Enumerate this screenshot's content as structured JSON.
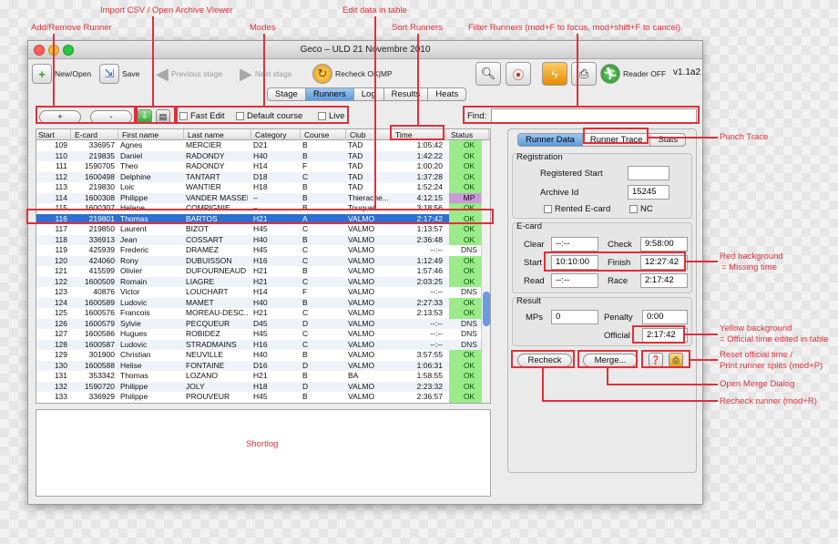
{
  "annotations": {
    "add_remove": "Add/Remove Runner",
    "import_csv": "Import CSV / Open Archive Viewer",
    "modes": "Modes",
    "edit_data": "Edit data in table",
    "sort_runners": "Sort Runners",
    "filter_runners": "Filter Runners (mod+F to focus, mod+shift+F to cancel)",
    "punch_trace": "Punch Trace",
    "red_background_1": "Red background",
    "red_background_2": "= Missing time",
    "yellow_background_1": "Yellow background",
    "yellow_background_2": "= Official time edited in table",
    "reset_official_1": "Reset official time /",
    "reset_official_2": "Print runner splits (mod+P)",
    "open_merge": "Open Merge Dialog",
    "recheck_runner": "Recheck runner (mod+R)",
    "shortlog": "Shortlog"
  },
  "window": {
    "title": "Geco – ULD 21 Novembre 2010",
    "version": "v1.1a2"
  },
  "toolbar": {
    "new_open": "New/Open",
    "save": "Save",
    "previous_stage": "Previous stage",
    "next_stage": "Next stage",
    "recheck": "Recheck OK|MP",
    "reader": "Reader OFF"
  },
  "tabs": [
    "Stage",
    "Runners",
    "Log",
    "Results",
    "Heats"
  ],
  "controls": {
    "add": "+",
    "remove": "-",
    "fast_edit": "Fast Edit",
    "default_course": "Default course",
    "live": "Live",
    "find_label": "Find:",
    "find_value": ""
  },
  "table": {
    "headers": [
      "Start",
      "E-card",
      "First name",
      "Last name",
      "Category",
      "Course",
      "Club",
      "Time",
      "Status"
    ],
    "rows": [
      [
        "109",
        "336957",
        "Agnes",
        "MERCIER",
        "D21",
        "B",
        "TAD",
        "1:05:42",
        "OK"
      ],
      [
        "110",
        "219835",
        "Daniel",
        "RADONDY",
        "H40",
        "B",
        "TAD",
        "1:42:22",
        "OK"
      ],
      [
        "111",
        "1590705",
        "Theo",
        "RADONDY",
        "H14",
        "F",
        "TAD",
        "1:00:20",
        "OK"
      ],
      [
        "112",
        "1600498",
        "Delphine",
        "TANTART",
        "D18",
        "C",
        "TAD",
        "1:37:28",
        "OK"
      ],
      [
        "113",
        "219830",
        "Loic",
        "WANTIER",
        "H18",
        "B",
        "TAD",
        "1:52:24",
        "OK"
      ],
      [
        "114",
        "1600308",
        "Philippe",
        "VANDER MASSEN",
        "–",
        "B",
        "Thierache...",
        "4:12:15",
        "MP"
      ],
      [
        "115",
        "1600307",
        "Helene",
        "COMPIGNIE",
        "–",
        "B",
        "Touquet...",
        "3:18:56",
        "OK"
      ],
      [
        "116",
        "219801",
        "Thomas",
        "BARTOS",
        "H21",
        "A",
        "VALMO",
        "2:17:42",
        "OK"
      ],
      [
        "117",
        "219850",
        "Laurent",
        "BIZOT",
        "H45",
        "C",
        "VALMO",
        "1:13:57",
        "OK"
      ],
      [
        "118",
        "336913",
        "Jean",
        "COSSART",
        "H40",
        "B",
        "VALMO",
        "2:36:48",
        "OK"
      ],
      [
        "119",
        "425939",
        "Frederic",
        "DRAMEZ",
        "H45",
        "C",
        "VALMO",
        "--:--",
        "DNS"
      ],
      [
        "120",
        "424060",
        "Rony",
        "DUBUISSON",
        "H16",
        "C",
        "VALMO",
        "1:12:49",
        "OK"
      ],
      [
        "121",
        "415599",
        "Olivier",
        "DUFOURNEAUD",
        "H21",
        "B",
        "VALMO",
        "1:57:46",
        "OK"
      ],
      [
        "122",
        "1600509",
        "Romain",
        "LIAGRE",
        "H21",
        "C",
        "VALMO",
        "2:03:25",
        "OK"
      ],
      [
        "123",
        "40876",
        "Victor",
        "LOUCHART",
        "H14",
        "F",
        "VALMO",
        "--:--",
        "DNS"
      ],
      [
        "124",
        "1600589",
        "Ludovic",
        "MAMET",
        "H40",
        "B",
        "VALMO",
        "2:27:33",
        "OK"
      ],
      [
        "125",
        "1600576",
        "Francois",
        "MOREAU-DESC...",
        "H21",
        "C",
        "VALMO",
        "2:13:53",
        "OK"
      ],
      [
        "126",
        "1600579",
        "Sylvie",
        "PECQUEUR",
        "D45",
        "D",
        "VALMO",
        "--:--",
        "DNS"
      ],
      [
        "127",
        "1600586",
        "Hugues",
        "ROBIDEZ",
        "H45",
        "C",
        "VALMO",
        "--:--",
        "DNS"
      ],
      [
        "128",
        "1600587",
        "Ludovic",
        "STRADMAINS",
        "H16",
        "C",
        "VALMO",
        "--:--",
        "DNS"
      ],
      [
        "129",
        "301900",
        "Christian",
        "NEUVILLE",
        "H40",
        "B",
        "VALMO",
        "3:57:55",
        "OK"
      ],
      [
        "130",
        "1600588",
        "Helise",
        "FONTAINE",
        "D16",
        "D",
        "VALMO",
        "1:06:31",
        "OK"
      ],
      [
        "131",
        "353342",
        "Thomas",
        "LOZANO",
        "H21",
        "B",
        "BA",
        "1:58:55",
        "OK"
      ],
      [
        "132",
        "1590720",
        "Philippe",
        "JOLY",
        "H18",
        "D",
        "VALMO",
        "2:23:32",
        "OK"
      ],
      [
        "133",
        "336929",
        "Philippe",
        "PROUVEUR",
        "H45",
        "B",
        "VALMO",
        "2:36:57",
        "OK"
      ],
      [
        "134",
        "1600591",
        "Charles",
        "POITEL",
        "H45",
        "B",
        "VALMO",
        "--:--",
        "DNS"
      ]
    ]
  },
  "right_panel": {
    "tabs": [
      "Runner Data",
      "Runner Trace",
      "Stats"
    ],
    "registration": {
      "title": "Registration",
      "registered_start_label": "Registered Start",
      "registered_start_value": "",
      "archive_id_label": "Archive Id",
      "archive_id_value": "15245",
      "rented_ecard": "Rented E-card",
      "nc": "NC"
    },
    "ecard": {
      "title": "E-card",
      "clear_label": "Clear",
      "clear_value": "--:--",
      "check_label": "Check",
      "check_value": "9:58:00",
      "start_label": "Start",
      "start_value": "10:10:00",
      "finish_label": "Finish",
      "finish_value": "12:27:42",
      "read_label": "Read",
      "read_value": "--:--",
      "race_label": "Race",
      "race_value": "2:17:42"
    },
    "result": {
      "title": "Result",
      "mps_label": "MPs",
      "mps_value": "0",
      "penalty_label": "Penalty",
      "penalty_value": "0:00",
      "official_label": "Official",
      "official_value": "2:17:42"
    },
    "recheck_button": "Recheck",
    "merge_button": "Merge..."
  },
  "colors": {
    "ok": "#9beb8a",
    "mp": "#c79ad8",
    "selection": "#2f6fd0",
    "annotation": "#e0303a"
  }
}
